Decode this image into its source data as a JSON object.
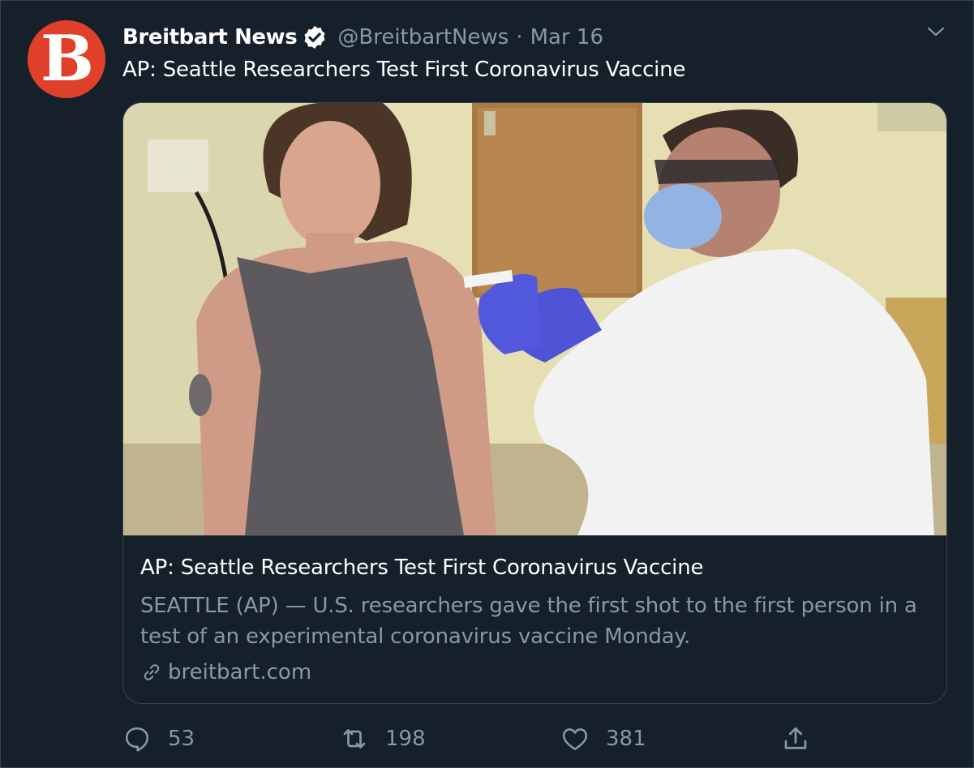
{
  "tweet": {
    "author_name": "Breitbart News",
    "author_handle": "@BreitbartNews",
    "separator": "·",
    "date": "Mar 16",
    "avatar_letter": "B",
    "text": "AP: Seattle Researchers Test First Coronavirus Vaccine"
  },
  "card": {
    "title": "AP: Seattle Researchers Test First Coronavirus Vaccine",
    "description": "SEATTLE (AP) — U.S. researchers gave the first shot to the first person in a test of an experimental coronavirus vaccine Monday.",
    "domain": "breitbart.com"
  },
  "actions": {
    "replies": "53",
    "retweets": "198",
    "likes": "381"
  },
  "icons": {
    "verified": "verified-badge-icon",
    "caret": "chevron-down-icon",
    "link": "link-icon",
    "reply": "reply-icon",
    "retweet": "retweet-icon",
    "like": "heart-icon",
    "share": "share-icon"
  },
  "colors": {
    "background": "#15202b",
    "border": "#38444d",
    "text_primary": "#ffffff",
    "text_secondary": "#8899a6",
    "avatar_brand": "#e0402a"
  }
}
